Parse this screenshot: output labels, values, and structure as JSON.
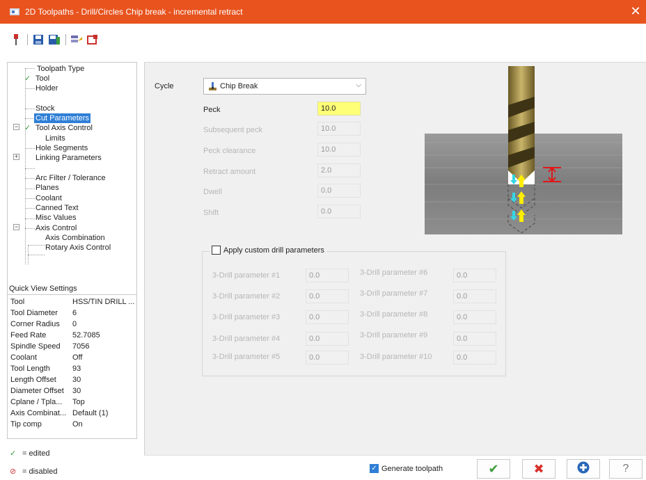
{
  "window": {
    "title": "2D Toolpaths - Drill/Circles Chip break - incremental retract",
    "close_label": "✕"
  },
  "tree": {
    "items": [
      {
        "label": "Toolpath Type"
      },
      {
        "label": "Tool",
        "checked": true
      },
      {
        "label": "Holder"
      },
      {
        "label": ""
      },
      {
        "label": "Stock"
      },
      {
        "label": "Cut Parameters",
        "selected": true
      },
      {
        "label": "Tool Axis Control",
        "checked": true,
        "expander": "minus"
      },
      {
        "label": "Limits"
      },
      {
        "label": "Hole Segments"
      },
      {
        "label": "Linking Parameters",
        "expander": "plus"
      },
      {
        "label": ""
      },
      {
        "label": "Arc Filter / Tolerance"
      },
      {
        "label": "Planes"
      },
      {
        "label": "Coolant"
      },
      {
        "label": "Canned Text"
      },
      {
        "label": "Misc Values"
      },
      {
        "label": "Axis Control",
        "expander": "minus"
      },
      {
        "label": "Axis Combination"
      },
      {
        "label": "Rotary Axis Control"
      }
    ]
  },
  "quick_view": {
    "title": "Quick View Settings",
    "rows": [
      {
        "name": "Tool",
        "value": "HSS/TIN DRILL ..."
      },
      {
        "name": "Tool Diameter",
        "value": "6"
      },
      {
        "name": "Corner Radius",
        "value": "0"
      },
      {
        "name": "Feed Rate",
        "value": "52.7085"
      },
      {
        "name": "Spindle Speed",
        "value": "7056"
      },
      {
        "name": "Coolant",
        "value": "Off"
      },
      {
        "name": "Tool Length",
        "value": "93"
      },
      {
        "name": "Length Offset",
        "value": "30"
      },
      {
        "name": "Diameter Offset",
        "value": "30"
      },
      {
        "name": "Cplane / Tpla...",
        "value": "Top"
      },
      {
        "name": "Axis Combinat...",
        "value": "Default (1)"
      },
      {
        "name": "Tip comp",
        "value": "On"
      }
    ]
  },
  "legend": {
    "edited": "= edited",
    "disabled": "= disabled",
    "edited_color": "#3c9c3c",
    "disabled_color": "#d23b3b"
  },
  "params": {
    "cycle_label": "Cycle",
    "cycle_value": "Chip Break",
    "fields": [
      {
        "label": "Peck",
        "value": "10.0",
        "enabled": true
      },
      {
        "label": "Subsequent peck",
        "value": "10.0",
        "enabled": false
      },
      {
        "label": "Peck clearance",
        "value": "10.0",
        "enabled": false
      },
      {
        "label": "Retract amount",
        "value": "2.0",
        "enabled": false
      },
      {
        "label": "Dwell",
        "value": "0.0",
        "enabled": false
      },
      {
        "label": "Shift",
        "value": "0.0",
        "enabled": false
      }
    ]
  },
  "custom_drill": {
    "title": "Apply custom drill parameters",
    "checked": false,
    "left": [
      {
        "label": "3-Drill parameter #1",
        "value": "0.0"
      },
      {
        "label": "3-Drill parameter #2",
        "value": "0.0"
      },
      {
        "label": "3-Drill parameter #3",
        "value": "0.0"
      },
      {
        "label": "3-Drill parameter #4",
        "value": "0.0"
      },
      {
        "label": "3-Drill parameter #5",
        "value": "0.0"
      }
    ],
    "right": [
      {
        "label": "3-Drill parameter #6",
        "value": "0.0"
      },
      {
        "label": "3-Drill parameter #7",
        "value": "0.0"
      },
      {
        "label": "3-Drill parameter #8",
        "value": "0.0"
      },
      {
        "label": "3-Drill parameter #9",
        "value": "0.0"
      },
      {
        "label": "3-Drill parameter #10",
        "value": "0.0"
      }
    ]
  },
  "bottom": {
    "generate_label": "Generate toolpath",
    "generate_checked": true,
    "ok_icon": "check-icon",
    "cancel_icon": "x-icon",
    "apply_icon": "plus-icon",
    "help_icon": "question-icon"
  },
  "colors": {
    "titlebar": "#e8531e",
    "selection": "#2f7fd6",
    "peck_highlight": "#ffff77",
    "ok_green": "#3c9c3c",
    "cancel_red": "#d8322c",
    "apply_blue": "#2a67b8"
  }
}
